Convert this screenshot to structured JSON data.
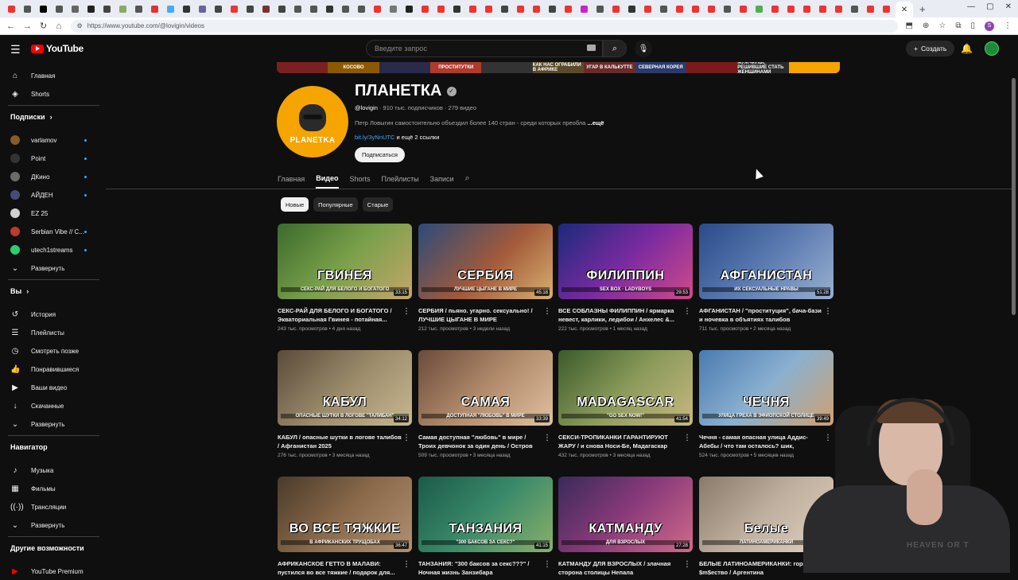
{
  "browser": {
    "url": "https://www.youtube.com/@lovigin/videos",
    "tab_colors": [
      "#e33",
      "#555",
      "#000",
      "#555",
      "#666",
      "#222",
      "#444",
      "#8a6",
      "#555",
      "#d33",
      "#4af",
      "#333",
      "#669",
      "#444",
      "#e33",
      "#444",
      "#733",
      "#444",
      "#555",
      "#555",
      "#333",
      "#555",
      "#555",
      "#e33",
      "#777",
      "#222",
      "#e33",
      "#e33",
      "#333",
      "#e33",
      "#e33",
      "#444",
      "#e33",
      "#e33",
      "#444",
      "#e33",
      "#c2c",
      "#555",
      "#e33",
      "#333",
      "#e33",
      "#555",
      "#e33",
      "#e33",
      "#e33",
      "#555",
      "#e33",
      "#5a5",
      "#e33",
      "#e33",
      "#e33",
      "#e33",
      "#e33",
      "#555",
      "#e33",
      "#e33"
    ]
  },
  "header": {
    "logo_text": "YouTube",
    "search_placeholder": "Введите запрос",
    "create_label": "Создать"
  },
  "sidebar": {
    "main": [
      {
        "label": "Главная",
        "icon": "home-icon",
        "glyph": "⌂"
      },
      {
        "label": "Shorts",
        "icon": "shorts-icon",
        "glyph": "◈"
      }
    ],
    "subscriptions_heading": "Подписки",
    "subscriptions": [
      {
        "label": "varlamov",
        "color": "#8b5a2b"
      },
      {
        "label": "Point",
        "color": "#333333"
      },
      {
        "label": "ДКино",
        "color": "#6b6b6b"
      },
      {
        "label": "АЙДЕН",
        "color": "#4a4a7a"
      },
      {
        "label": "EZ 25",
        "color": "#d0d0d0"
      },
      {
        "label": "Serbian Vibe // C...",
        "color": "#c0392b"
      },
      {
        "label": "utech1streams",
        "color": "#2ecc71"
      }
    ],
    "expand_label": "Развернуть",
    "you_heading": "Вы",
    "you_items": [
      {
        "label": "История",
        "icon": "history-icon",
        "glyph": "↺"
      },
      {
        "label": "Плейлисты",
        "icon": "playlists-icon",
        "glyph": "☰"
      },
      {
        "label": "Смотреть позже",
        "icon": "watch-later-icon",
        "glyph": "◷"
      },
      {
        "label": "Понравившиеся",
        "icon": "like-icon",
        "glyph": "👍"
      },
      {
        "label": "Ваши видео",
        "icon": "your-videos-icon",
        "glyph": "▶"
      },
      {
        "label": "Скачанные",
        "icon": "download-icon",
        "glyph": "↓"
      },
      {
        "label": "Развернуть",
        "icon": "chevron-down-icon",
        "glyph": "⌄"
      }
    ],
    "navigator_heading": "Навигатор",
    "navigator_items": [
      {
        "label": "Музыка",
        "icon": "music-icon",
        "glyph": "♪"
      },
      {
        "label": "Фильмы",
        "icon": "movies-icon",
        "glyph": "▦"
      },
      {
        "label": "Трансляции",
        "icon": "live-icon",
        "glyph": "((·))"
      },
      {
        "label": "Развернуть",
        "icon": "chevron-down-icon",
        "glyph": "⌄"
      }
    ],
    "more_heading": "Другие возможности",
    "more_items": [
      {
        "label": "YouTube Premium",
        "icon": "youtube-premium-icon",
        "glyph": "▶"
      }
    ]
  },
  "banner": {
    "segments": [
      {
        "text": "",
        "color": "#7a2020"
      },
      {
        "text": "КОСОВО",
        "color": "#8b5a00"
      },
      {
        "text": "",
        "color": "#2a2a4a"
      },
      {
        "text": "ПРОСТИТУТКИ",
        "color": "#b03a2e"
      },
      {
        "text": "",
        "color": "#333"
      },
      {
        "text": "КАК НАС ОГРАБИЛИ В АФРИКЕ",
        "color": "#5a4a2a"
      },
      {
        "text": "УГАР В КАЛЬКУТТЕ",
        "color": "#6a2a2a"
      },
      {
        "text": "СЕВЕРНАЯ КОРЕЯ",
        "color": "#2a3a6a"
      },
      {
        "text": "",
        "color": "#7a1a1a"
      },
      {
        "text": "МУЖЧИНЫ, РЕШИВШИЕ СТАТЬ ЖЕНЩИНАМИ",
        "color": "#2a2a2a"
      },
      {
        "text": "",
        "color": "#f5a400"
      }
    ]
  },
  "channel": {
    "name": "ПЛАНЕТКА",
    "avatar_wordmark": "PLANETKA",
    "handle": "@lovigin",
    "stats": " · 910 тыс. подписчиков · 279 видео",
    "description": "Петр Ловыгин самостоятельно объездил более 140 стран - среди которых преобла",
    "more_label": "...ещё",
    "link": "bit.ly/3yNnUTC",
    "more_links": " и ещё 2 ссылки",
    "subscribe_label": "Подписаться"
  },
  "tabs": [
    {
      "label": "Главная",
      "active": false
    },
    {
      "label": "Видео",
      "active": true
    },
    {
      "label": "Shorts",
      "active": false
    },
    {
      "label": "Плейлисты",
      "active": false
    },
    {
      "label": "Записи",
      "active": false
    }
  ],
  "chips": [
    {
      "label": "Новые",
      "active": true
    },
    {
      "label": "Популярные",
      "active": false
    },
    {
      "label": "Старые",
      "active": false
    }
  ],
  "videos": [
    {
      "thumb_title": "ГВИНЕЯ",
      "thumb_sub": "СЕКС-РАЙ ДЛЯ БЕЛОГО И БОГАТОГО",
      "duration": "33:15",
      "bg": "linear-gradient(135deg,#3b6b2b,#7aa04a 50%,#c5a56a)",
      "title": "СЕКС-РАЙ ДЛЯ БЕЛОГО И БОГАТОГО / Экваториальная Гвинея - потайная...",
      "meta": "243 тыс. просмотров • 4 дня назад"
    },
    {
      "thumb_title": "СЕРБИЯ",
      "thumb_sub": "ЛУЧШИЕ ЦЫГАНЕ В МИРЕ",
      "duration": "45:18",
      "bg": "linear-gradient(135deg,#2b4b7a,#a35a3a 55%,#d8b070)",
      "title": "СЕРБИЯ / пьяно. угарно. сексуально! / ЛУЧШИЕ ЦЫГАНЕ В МИРЕ",
      "meta": "212 тыс. просмотров • 3 недели назад"
    },
    {
      "thumb_title": "ФИЛИППИН",
      "thumb_sub": "SEX BOX · LADYBOYS",
      "duration": "29:53",
      "bg": "linear-gradient(135deg,#1a2a7a,#7a2aa0 50%,#d04a8a)",
      "title": "ВСЕ СОБЛАЗНЫ ФИЛИППИН / ярмарка невест, карлики, ледибои / Анхелес &...",
      "meta": "222 тыс. просмотров • 1 месяц назад"
    },
    {
      "thumb_title": "АФГАНИСТАН",
      "thumb_sub": "ИХ СЕКСУАЛЬНЫЕ НРАВЫ",
      "duration": "51:28",
      "bg": "linear-gradient(135deg,#2a4a8a,#5a7ab0 50%,#9ab0d0)",
      "title": "АФГАНИСТАН / \"проституция\", бача-бази и ночевка в объятиях талибов",
      "meta": "711 тыс. просмотров • 2 месяца назад"
    },
    {
      "thumb_title": "КАБУЛ",
      "thumb_sub": "ОПАСНЫЕ ШУТКИ В ЛОГОВЕ \"ТАЛИБАН\"",
      "duration": "34:12",
      "bg": "linear-gradient(135deg,#5a4a3a,#9a8a6a 50%,#c8b890)",
      "title": "КАБУЛ / опасные шутки в логове талибов / Афганистан 2025",
      "meta": "276 тыс. просмотров • 3 месяца назад"
    },
    {
      "thumb_title": "САМАЯ",
      "thumb_sub": "ДОСТУПНАЯ \"ЛЮБОВЬ\" В МИРЕ",
      "duration": "33:39",
      "bg": "linear-gradient(135deg,#6a4a3a,#b08a6a 50%,#e0c0a0)",
      "title": "Самая доступная \"любовь\" в мире / Троих девчонок за один день / Остров Носи Бе...",
      "meta": "509 тыс. просмотров • 3 месяца назад"
    },
    {
      "thumb_title": "MADAGASCAR",
      "thumb_sub": "\"GO SEX NOW!\"",
      "duration": "41:54",
      "bg": "linear-gradient(135deg,#3a5a2a,#8a9a5a 50%,#c8b880)",
      "title": "СЕКСИ-ТРОПИКАНКИ ГАРАНТИРУЮТ ЖАРУ / и снова Носи-Бе, Мадагаскар",
      "meta": "432 тыс. просмотров • 3 месяца назад"
    },
    {
      "thumb_title": "ЧЕЧНЯ",
      "thumb_sub": "УЛИЦА ГРЕХА В ЭФИОПСКОЙ СТОЛИЦЕ",
      "duration": "39:49",
      "bg": "linear-gradient(135deg,#4a7ab0,#8ab0d0 50%,#d0a070)",
      "title": "Чечня - самая опасная улица Аддис-Абебы / что там осталось? шик, бордели...",
      "meta": "524 тыс. просмотров • 5 месяцев назад"
    },
    {
      "thumb_title": "ВО ВСЕ ТЯЖКИЕ",
      "thumb_sub": "В АФРИКАНСКИХ ТРУЩОБАХ",
      "duration": "36:47",
      "bg": "linear-gradient(135deg,#4a3a2a,#8a6a4a 50%,#b09070)",
      "title": "АФРИКАНСКОЕ ГЕТТО В МАЛАВИ: пустился во все тяжкие / подарок для...",
      "meta": ""
    },
    {
      "thumb_title": "ТАНЗАНИЯ",
      "thumb_sub": "\"300 БАКСОВ ЗА СЕКС?\"",
      "duration": "41:15",
      "bg": "linear-gradient(135deg,#1a5a4a,#3a8a6a 50%,#8ab06a)",
      "title": "ТАНЗАНИЯ: \"300 баксов за секс???\" / Ночная жизнь Занзибара",
      "meta": ""
    },
    {
      "thumb_title": "КАТМАНДУ",
      "thumb_sub": "ДЛЯ ВЗРОСЛЫХ",
      "duration": "27:28",
      "bg": "linear-gradient(135deg,#3a2a5a,#8a3a7a 50%,#d06a8a)",
      "title": "КАТМАНДУ ДЛЯ ВЗРОСЛЫХ / злачная сторона столицы Непала",
      "meta": ""
    },
    {
      "thumb_title": "Белые",
      "thumb_sub": "ЛАТИНОАМЕРИКАНКИ",
      "duration": "",
      "bg": "linear-gradient(135deg,#8a7a6a,#c0b0a0 50%,#e0d0c0)",
      "title": "БЕЛЫЕ ЛАТИНОАМЕРИКАНКИ: горячие и $m$ество / Аргентина",
      "meta": ""
    }
  ],
  "webcam": {
    "shirt_text": "HEAVEN OR T"
  }
}
